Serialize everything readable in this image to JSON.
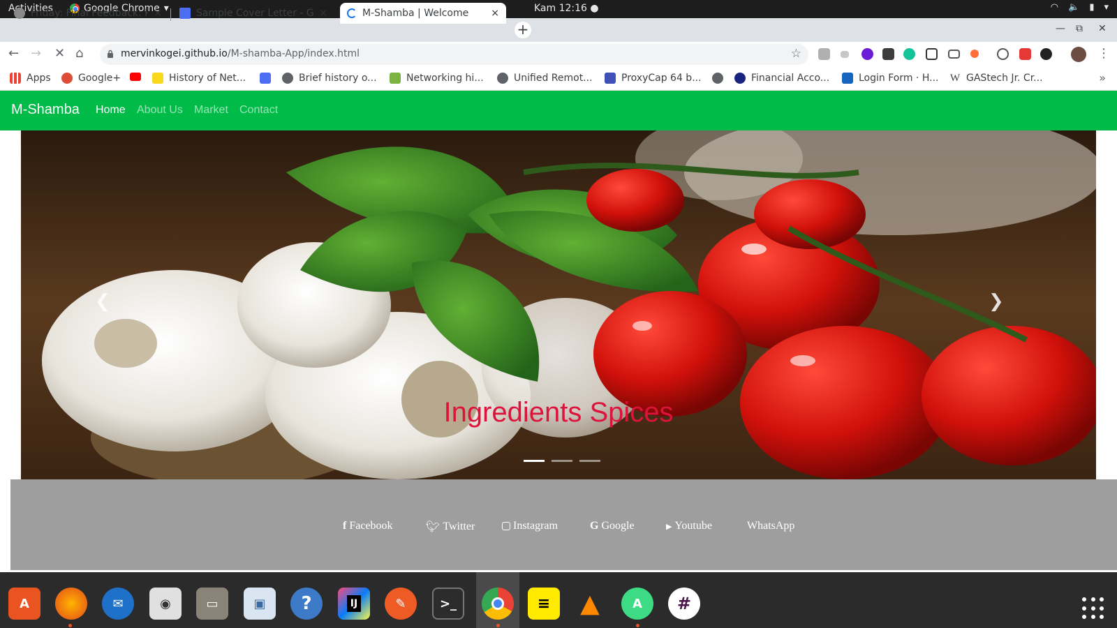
{
  "system": {
    "activities": "Activities",
    "app_menu": "Google Chrome",
    "clock": "Kam 12:16"
  },
  "tabs": [
    {
      "title": "Friday: Final Feedback: Pr",
      "close": "×",
      "favicon": "pinwheel-icon"
    },
    {
      "title": "Sample Cover Letter - Goo",
      "close": "×",
      "favicon": "google-docs-icon"
    },
    {
      "title": "M-Shamba | Welcome",
      "close": "×",
      "favicon": "loading-spinner-icon"
    }
  ],
  "toolbar": {
    "url_host": "mervinkogei.github.io",
    "url_path": "/M-shamba-App/index.html"
  },
  "bookmarks": [
    {
      "label": "Apps",
      "icon": "apps-grid-icon"
    },
    {
      "label": "Google+",
      "icon": "google-plus-icon"
    },
    {
      "label": "",
      "icon": "youtube-icon"
    },
    {
      "label": "History of Net...",
      "icon": "history-icon"
    },
    {
      "label": "",
      "icon": "docs-icon"
    },
    {
      "label": "Brief history o...",
      "icon": "globe-icon"
    },
    {
      "label": "Networking hi...",
      "icon": "network-icon"
    },
    {
      "label": "Unified Remot...",
      "icon": "globe-icon"
    },
    {
      "label": "ProxyCap 64 b...",
      "icon": "proxycap-icon"
    },
    {
      "label": "",
      "icon": "globe-icon"
    },
    {
      "label": "Financial Acco...",
      "icon": "finance-icon"
    },
    {
      "label": "Login Form · H...",
      "icon": "css-icon"
    },
    {
      "label": "GAStech Jr. Cr...",
      "icon": "wikipedia-icon"
    }
  ],
  "site": {
    "brand": "M-Shamba",
    "nav": [
      "Home",
      "About Us",
      "Market",
      "Contact"
    ],
    "active_nav": "Home",
    "caption": "Ingredients Spices",
    "slides": 3,
    "active_slide": 1,
    "social": [
      {
        "label": "Facebook",
        "icon": "facebook-icon"
      },
      {
        "label": "Twitter",
        "icon": "twitter-icon"
      },
      {
        "label": "Instagram",
        "icon": "instagram-icon"
      },
      {
        "label": "Google",
        "icon": "google-icon"
      },
      {
        "label": "Youtube",
        "icon": "youtube-icon"
      },
      {
        "label": "WhatsApp",
        "icon": ""
      }
    ]
  },
  "colors": {
    "navbar": "#00bb48",
    "caption": "#dc143c",
    "footer": "#9e9e9e"
  },
  "dock": [
    "ubuntu-software-icon",
    "firefox-icon",
    "thunderbird-icon",
    "rhythmbox-icon",
    "files-icon",
    "image-viewer-icon",
    "help-icon",
    "intellij-icon",
    "postman-icon",
    "terminal-icon",
    "chrome-icon",
    "notes-icon",
    "vlc-icon",
    "android-studio-icon",
    "slack-icon"
  ]
}
